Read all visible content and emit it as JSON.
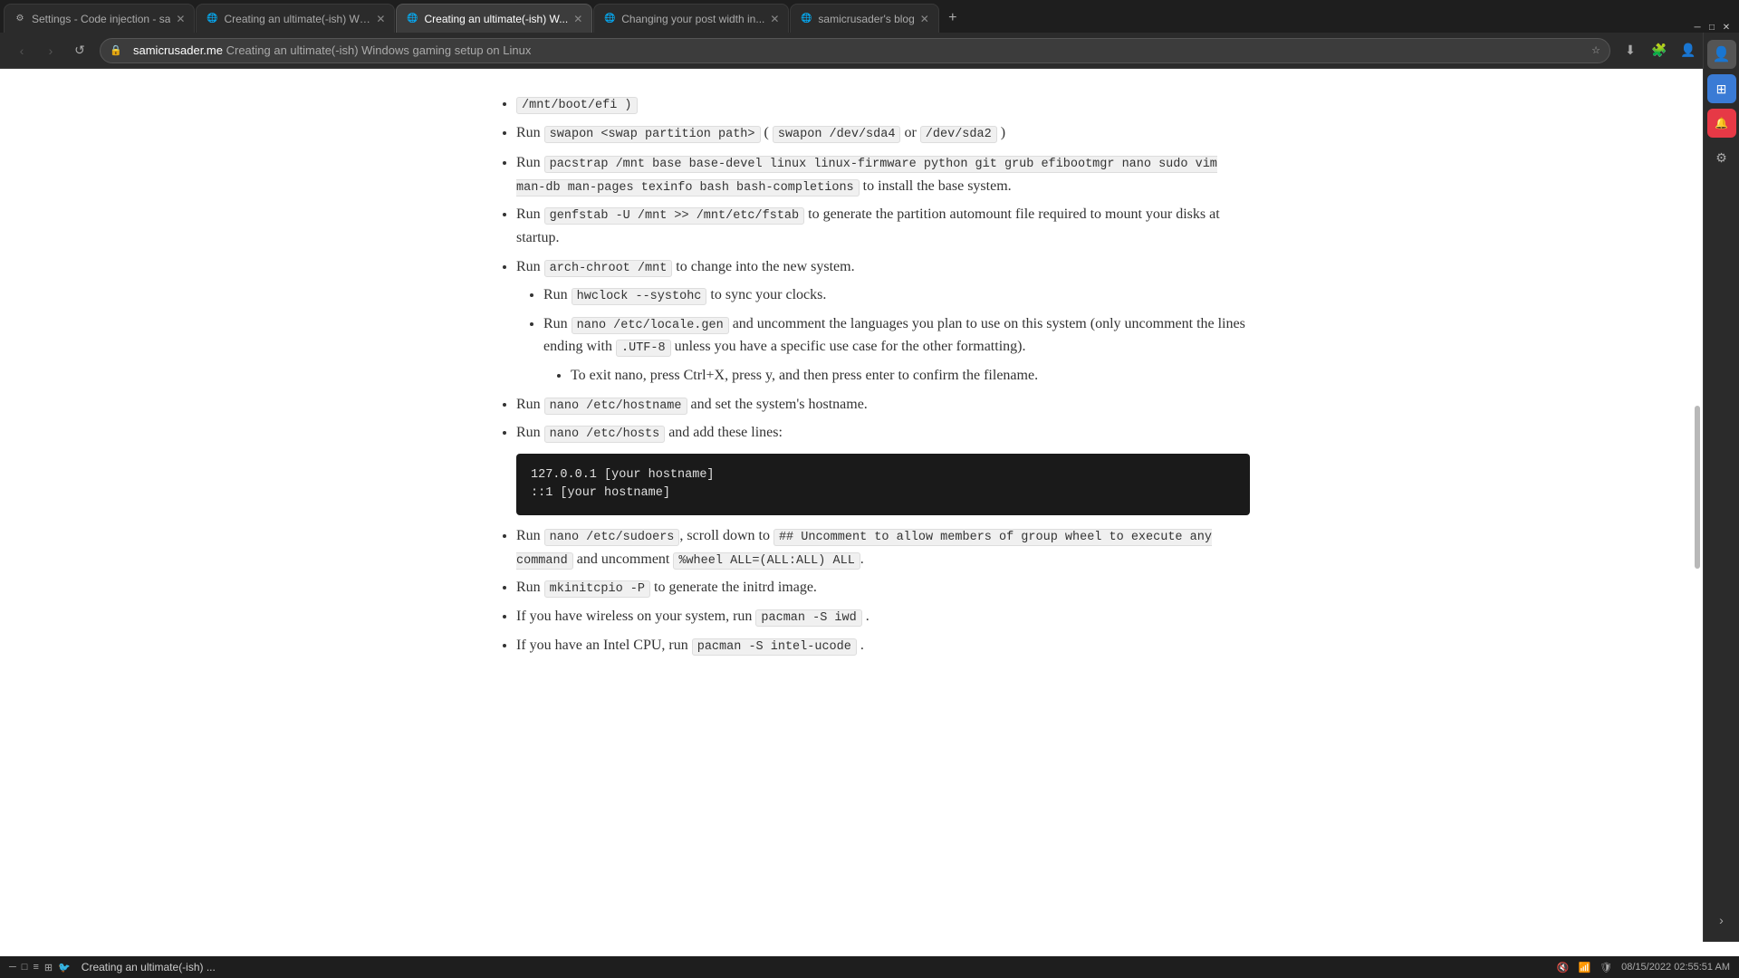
{
  "browser": {
    "tabs": [
      {
        "id": "tab-1",
        "label": "Settings - Code injection - sa",
        "favicon": "⚙",
        "active": false
      },
      {
        "id": "tab-2",
        "label": "Creating an ultimate(-ish) Wi...",
        "favicon": "🌐",
        "active": false
      },
      {
        "id": "tab-3",
        "label": "Creating an ultimate(-ish) W...",
        "favicon": "🌐",
        "active": true
      },
      {
        "id": "tab-4",
        "label": "Changing your post width in...",
        "favicon": "🌐",
        "active": false
      },
      {
        "id": "tab-5",
        "label": "samicrusader's blog",
        "favicon": "🌐",
        "active": false
      }
    ],
    "new_tab_label": "+",
    "address": {
      "domain": "samicrusader.me",
      "path": " Creating an ultimate(-ish) Windows gaming setup on Linux"
    }
  },
  "article": {
    "lines": [
      {
        "type": "bullet",
        "content_parts": [
          {
            "type": "text",
            "text": "/mnt/boot/efi )"
          }
        ]
      },
      {
        "type": "bullet",
        "text_before": "Run ",
        "code": "swapon <swap partition path>",
        "text_after": " ( ",
        "code2": "swapon /dev/sda4",
        "text_after2": " or ",
        "code3": "/dev/sda2",
        "text_after3": " )"
      },
      {
        "type": "blank"
      },
      {
        "type": "bullet",
        "run_cmd": "pacstrap /mnt base base-devel linux linux-firmware python git grub efibootmgr nano sudo vim man-db man-pages texinfo bash bash-completions",
        "suffix": " to install the base system."
      },
      {
        "type": "bullet",
        "run_cmd": "genfstab -U /mnt >> /mnt/etc/fstab",
        "suffix": " to generate the partition automount file required to mount your disks at startup."
      },
      {
        "type": "bullet",
        "run_cmd": "arch-chroot /mnt",
        "suffix": " to change into the new system."
      },
      {
        "type": "sub_bullet",
        "run_cmd": "hwclock --systohc",
        "suffix": " to sync your clocks."
      },
      {
        "type": "sub_bullet",
        "run_cmd": "nano /etc/locale.gen",
        "suffix": " and uncomment the languages you plan to use on this system (only uncomment the lines ending with ",
        "inline_code": ".UTF-8",
        "suffix2": " unless you have a specific use case for the other formatting)."
      },
      {
        "type": "sub_sub_bullet",
        "text": "To exit nano, press Ctrl+X, press y, and then press enter to confirm the filename."
      },
      {
        "type": "blank"
      },
      {
        "type": "sub_bullet",
        "run_cmd": "nano /etc/hostname",
        "suffix": " and set the system's hostname."
      },
      {
        "type": "sub_bullet",
        "run_cmd": "nano /etc/hosts",
        "suffix": " and add these lines:"
      },
      {
        "type": "code_block",
        "lines": [
          "127.0.0.1 [your hostname]",
          "::1 [your hostname]"
        ]
      },
      {
        "type": "sub_bullet",
        "run_cmd": "nano /etc/sudoers",
        "suffix": ", scroll down to ",
        "code_inline": "## Uncomment to allow members of group wheel to execute any command",
        "suffix2": " and uncomment ",
        "code_inline2": "%wheel ALL=(ALL:ALL) ALL",
        "suffix3": "."
      },
      {
        "type": "sub_bullet",
        "run_cmd": "mkinitcpio -P",
        "suffix": " to generate the initrd image."
      },
      {
        "type": "sub_bullet",
        "text_start": "If you have wireless on your system, run ",
        "run_cmd": "pacman -S iwd",
        "suffix": " ."
      },
      {
        "type": "sub_bullet",
        "text_start": "If you have an Intel CPU, run ",
        "run_cmd": "pacman -S intel-ucode",
        "suffix": " ."
      }
    ]
  },
  "taskbar": {
    "app_label": "Creating an ultimate(-ish) ...",
    "time": "08/15/2022 02:55:51 AM"
  },
  "sidebar": {
    "icons": [
      {
        "name": "profile-icon",
        "glyph": "👤"
      },
      {
        "name": "apps-icon",
        "glyph": "⊞"
      },
      {
        "name": "notification-icon",
        "glyph": "🔔",
        "color": "#e63946"
      },
      {
        "name": "settings-icon",
        "glyph": "⚙"
      },
      {
        "name": "expand-icon",
        "glyph": "›"
      }
    ]
  }
}
